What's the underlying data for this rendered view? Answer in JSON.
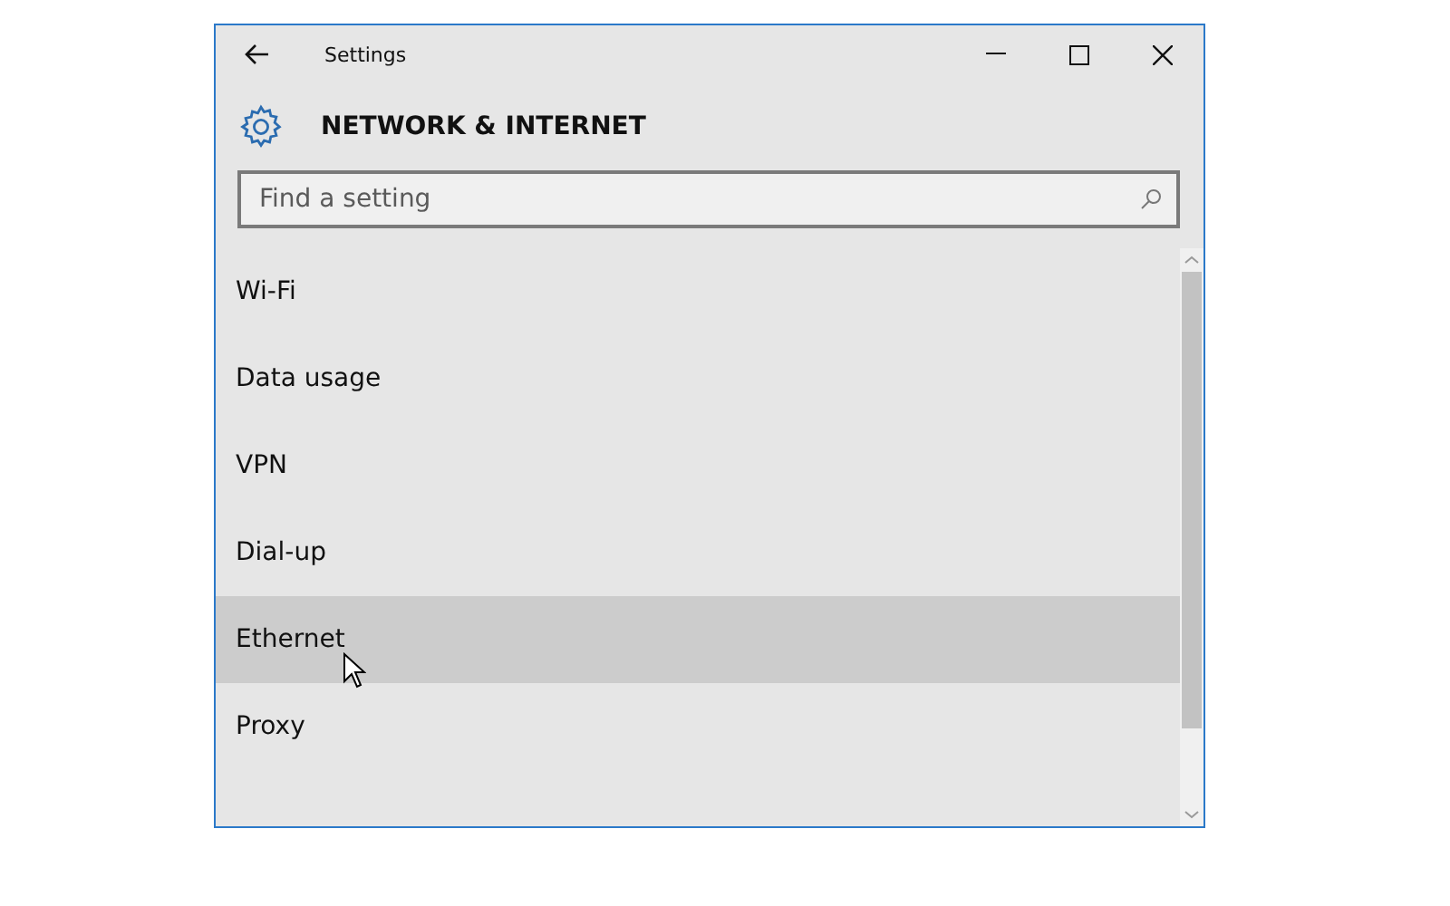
{
  "window": {
    "title": "Settings"
  },
  "header": {
    "title": "NETWORK & INTERNET"
  },
  "search": {
    "placeholder": "Find a setting"
  },
  "items": [
    {
      "label": "Wi-Fi",
      "selected": false
    },
    {
      "label": "Data usage",
      "selected": false
    },
    {
      "label": "VPN",
      "selected": false
    },
    {
      "label": "Dial-up",
      "selected": false
    },
    {
      "label": "Ethernet",
      "selected": true
    },
    {
      "label": "Proxy",
      "selected": false
    }
  ]
}
